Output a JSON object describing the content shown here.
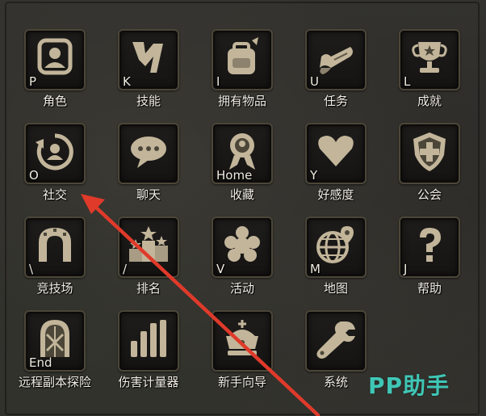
{
  "menu": {
    "items": [
      {
        "label": "角色",
        "hotkey": "P",
        "icon": "character-portrait-icon"
      },
      {
        "label": "技能",
        "hotkey": "K",
        "icon": "lightning-skill-icon"
      },
      {
        "label": "拥有物品",
        "hotkey": "I",
        "icon": "backpack-icon"
      },
      {
        "label": "任务",
        "hotkey": "U",
        "icon": "quest-scroll-icon"
      },
      {
        "label": "成就",
        "hotkey": "L",
        "icon": "trophy-icon"
      },
      {
        "label": "社交",
        "hotkey": "O",
        "icon": "social-refresh-icon"
      },
      {
        "label": "聊天",
        "hotkey": "",
        "icon": "chat-bubble-icon"
      },
      {
        "label": "收藏",
        "hotkey": "Home",
        "icon": "medal-ribbon-icon"
      },
      {
        "label": "好感度",
        "hotkey": "Y",
        "icon": "heart-icon"
      },
      {
        "label": "公会",
        "hotkey": "",
        "icon": "guild-shield-icon"
      },
      {
        "label": "竞技场",
        "hotkey": "\\",
        "icon": "arena-gate-icon"
      },
      {
        "label": "排名",
        "hotkey": "/",
        "icon": "ranking-podium-icon"
      },
      {
        "label": "活动",
        "hotkey": "V",
        "icon": "event-flower-icon"
      },
      {
        "label": "地图",
        "hotkey": "M",
        "icon": "globe-map-icon"
      },
      {
        "label": "帮助",
        "hotkey": "J",
        "icon": "question-mark-icon"
      },
      {
        "label": "远程副本探险",
        "hotkey": "End",
        "icon": "dungeon-door-icon"
      },
      {
        "label": "伤害计量器",
        "hotkey": "",
        "icon": "damage-meter-bars-icon"
      },
      {
        "label": "新手向导",
        "hotkey": "",
        "icon": "crown-guide-icon"
      },
      {
        "label": "系统",
        "hotkey": "",
        "icon": "wrench-icon"
      }
    ]
  },
  "watermark": {
    "text": "PP助手"
  },
  "colors": {
    "icon": "#c2b59a",
    "arrow": "#e03a2a",
    "watermark": "#3fc7b6"
  }
}
